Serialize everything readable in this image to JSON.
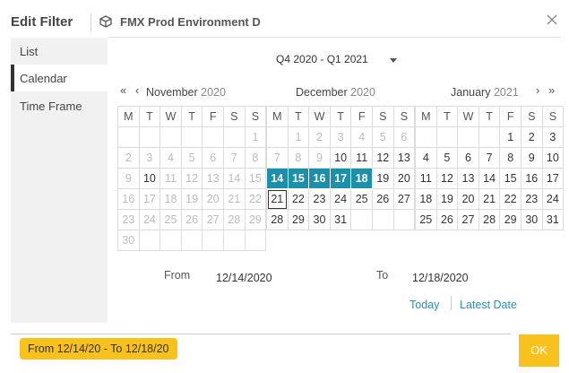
{
  "header": {
    "title": "Edit Filter",
    "environment": "FMX Prod Environment D"
  },
  "sidebar": {
    "items": [
      {
        "label": "List"
      },
      {
        "label": "Calendar"
      },
      {
        "label": "Time Frame"
      }
    ],
    "active": "Calendar"
  },
  "range_select": {
    "value": "Q4 2020 - Q1 2021"
  },
  "weekdays": [
    "M",
    "T",
    "W",
    "T",
    "F",
    "S",
    "S"
  ],
  "months": [
    {
      "name": "November",
      "year": "2020",
      "weeks": [
        [
          [
            "",
            ""
          ],
          [
            "",
            ""
          ],
          [
            "",
            ""
          ],
          [
            "",
            ""
          ],
          [
            "",
            ""
          ],
          [
            "",
            ""
          ],
          [
            "1",
            "m"
          ]
        ],
        [
          [
            "2",
            "m"
          ],
          [
            "3",
            "m"
          ],
          [
            "4",
            "m"
          ],
          [
            "5",
            "m"
          ],
          [
            "6",
            "m"
          ],
          [
            "7",
            "m"
          ],
          [
            "8",
            "m"
          ]
        ],
        [
          [
            "9",
            "m"
          ],
          [
            "10",
            "n"
          ],
          [
            "11",
            "m"
          ],
          [
            "12",
            "m"
          ],
          [
            "13",
            "m"
          ],
          [
            "14",
            "m"
          ],
          [
            "15",
            "m"
          ]
        ],
        [
          [
            "16",
            "m"
          ],
          [
            "17",
            "m"
          ],
          [
            "18",
            "m"
          ],
          [
            "19",
            "m"
          ],
          [
            "20",
            "m"
          ],
          [
            "21",
            "m"
          ],
          [
            "22",
            "m"
          ]
        ],
        [
          [
            "23",
            "m"
          ],
          [
            "24",
            "m"
          ],
          [
            "25",
            "m"
          ],
          [
            "26",
            "m"
          ],
          [
            "27",
            "m"
          ],
          [
            "28",
            "m"
          ],
          [
            "29",
            "m"
          ]
        ],
        [
          [
            "30",
            "m"
          ],
          [
            "",
            ""
          ],
          [
            "",
            ""
          ],
          [
            "",
            ""
          ],
          [
            "",
            ""
          ],
          [
            "",
            ""
          ],
          [
            "",
            ""
          ]
        ]
      ]
    },
    {
      "name": "December",
      "year": "2020",
      "weeks": [
        [
          [
            "",
            ""
          ],
          [
            "1",
            "m"
          ],
          [
            "2",
            "m"
          ],
          [
            "3",
            "m"
          ],
          [
            "4",
            "m"
          ],
          [
            "5",
            "m"
          ],
          [
            "6",
            "m"
          ]
        ],
        [
          [
            "7",
            "m"
          ],
          [
            "8",
            "m"
          ],
          [
            "9",
            "m"
          ],
          [
            "10",
            "n"
          ],
          [
            "11",
            "n"
          ],
          [
            "12",
            "n"
          ],
          [
            "13",
            "n"
          ]
        ],
        [
          [
            "14",
            "s"
          ],
          [
            "15",
            "s"
          ],
          [
            "16",
            "s"
          ],
          [
            "17",
            "s"
          ],
          [
            "18",
            "s"
          ],
          [
            "19",
            "n"
          ],
          [
            "20",
            "n"
          ]
        ],
        [
          [
            "21",
            "t"
          ],
          [
            "22",
            "n"
          ],
          [
            "23",
            "n"
          ],
          [
            "24",
            "n"
          ],
          [
            "25",
            "n"
          ],
          [
            "26",
            "n"
          ],
          [
            "27",
            "n"
          ]
        ],
        [
          [
            "28",
            "n"
          ],
          [
            "29",
            "n"
          ],
          [
            "30",
            "n"
          ],
          [
            "31",
            "n"
          ],
          [
            "",
            ""
          ],
          [
            "",
            ""
          ],
          [
            "",
            ""
          ]
        ]
      ]
    },
    {
      "name": "January",
      "year": "2021",
      "weeks": [
        [
          [
            "",
            ""
          ],
          [
            "",
            ""
          ],
          [
            "",
            ""
          ],
          [
            "",
            ""
          ],
          [
            "1",
            "n"
          ],
          [
            "2",
            "n"
          ],
          [
            "3",
            "n"
          ]
        ],
        [
          [
            "4",
            "n"
          ],
          [
            "5",
            "n"
          ],
          [
            "6",
            "n"
          ],
          [
            "7",
            "n"
          ],
          [
            "8",
            "n"
          ],
          [
            "9",
            "n"
          ],
          [
            "10",
            "n"
          ]
        ],
        [
          [
            "11",
            "n"
          ],
          [
            "12",
            "n"
          ],
          [
            "13",
            "n"
          ],
          [
            "14",
            "n"
          ],
          [
            "15",
            "n"
          ],
          [
            "16",
            "n"
          ],
          [
            "17",
            "n"
          ]
        ],
        [
          [
            "18",
            "n"
          ],
          [
            "19",
            "n"
          ],
          [
            "20",
            "n"
          ],
          [
            "21",
            "n"
          ],
          [
            "22",
            "n"
          ],
          [
            "23",
            "n"
          ],
          [
            "24",
            "n"
          ]
        ],
        [
          [
            "25",
            "n"
          ],
          [
            "26",
            "n"
          ],
          [
            "27",
            "n"
          ],
          [
            "28",
            "n"
          ],
          [
            "29",
            "n"
          ],
          [
            "30",
            "n"
          ],
          [
            "31",
            "n"
          ]
        ]
      ]
    }
  ],
  "from": {
    "label": "From",
    "value": "12/14/2020"
  },
  "to": {
    "label": "To",
    "value": "12/18/2020"
  },
  "links": {
    "today": "Today",
    "latest": "Latest Date"
  },
  "summary": "From 12/14/20 - To 12/18/20",
  "ok_label": "OK",
  "colors": {
    "accent": "#1c8fab",
    "highlight": "#f9c11b",
    "link": "#2a8fb0"
  }
}
